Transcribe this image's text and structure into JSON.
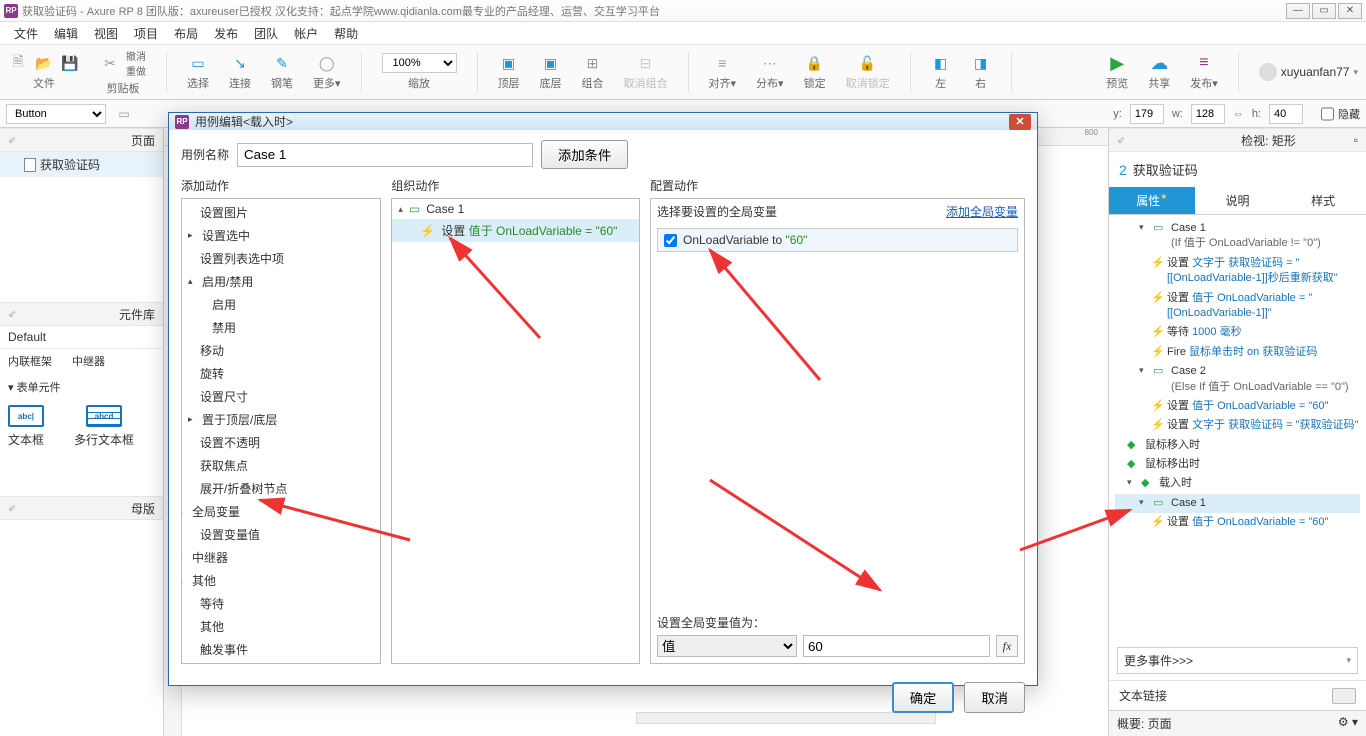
{
  "title": "获取验证码 - Axure RP 8 团队版：axureuser已授权 汉化支持：起点学院www.qidianla.com最专业的产品经理、运营、交互学习平台",
  "menu": [
    "文件",
    "编辑",
    "视图",
    "项目",
    "布局",
    "发布",
    "团队",
    "帐户",
    "帮助"
  ],
  "toolbar": {
    "groups": [
      {
        "label": "文件",
        "icons": [
          "□",
          "□",
          "□"
        ]
      },
      {
        "label": "剪贴板",
        "icons": [
          "✂",
          "📋"
        ],
        "extra": [
          "撤消",
          "重做"
        ]
      },
      {
        "label": "选择",
        "icon": "▭"
      },
      {
        "label": "连接",
        "icon": "↘"
      },
      {
        "label": "钢笔",
        "icon": "✎"
      },
      {
        "label": "更多▾",
        "icon": "◯"
      },
      {
        "label": "缩放",
        "zoom": "100%"
      },
      {
        "label": "顶层",
        "icon": "▣"
      },
      {
        "label": "底层",
        "icon": "▣"
      },
      {
        "label": "组合",
        "icon": "⊞"
      },
      {
        "label": "取消组合",
        "icon": "⊟"
      },
      {
        "label": "对齐▾",
        "icon": "≡"
      },
      {
        "label": "分布▾",
        "icon": "⋯"
      },
      {
        "label": "锁定",
        "icon": "🔒"
      },
      {
        "label": "取消锁定",
        "icon": "🔓"
      },
      {
        "label": "左",
        "icon": "◧"
      },
      {
        "label": "右",
        "icon": "◨"
      },
      {
        "label": "预览",
        "icon": "▶",
        "color": "#28a745"
      },
      {
        "label": "共享",
        "icon": "☁",
        "color": "#2196d6"
      },
      {
        "label": "发布▾",
        "icon": "≡",
        "color": "#8b3a8b"
      }
    ],
    "user": "xuyuanfan77"
  },
  "propbar": {
    "shape_select": "Button",
    "y_label": "y:",
    "y": "179",
    "w_label": "w:",
    "w": "128",
    "h_label": "h:",
    "h": "40",
    "hidden": "隐藏"
  },
  "left": {
    "page_panel": "页面",
    "page_item": "获取验证码",
    "lib_panel": "元件库",
    "default_lib": "Default",
    "lib_cats": [
      "内联框架",
      "中继器"
    ],
    "form_header": "表单元件",
    "lib_items": [
      "文本框",
      "多行文本框"
    ],
    "master_panel": "母版"
  },
  "modal": {
    "title": "用例编辑<载入时>",
    "case_name_label": "用例名称",
    "case_name": "Case 1",
    "add_condition": "添加条件",
    "col1_h": "添加动作",
    "actions": [
      "设置图片",
      "设置选中",
      "设置列表选中项",
      "启用/禁用",
      "启用",
      "禁用",
      "移动",
      "旋转",
      "设置尺寸",
      "置于顶层/底层",
      "设置不透明",
      "获取焦点",
      "展开/折叠树节点",
      "全局变量",
      "设置变量值",
      "中继器",
      "其他",
      "等待",
      "其他",
      "触发事件"
    ],
    "col2_h": "组织动作",
    "org_case": "Case 1",
    "org_action_prefix": "设置 ",
    "org_action_green": "值于 OnLoadVariable = \"60\"",
    "col3_h": "配置动作",
    "cfg_prompt": "选择要设置的全局变量",
    "add_global": "添加全局变量",
    "var_name": "OnLoadVariable to ",
    "var_value_green": "\"60\"",
    "value_label": "设置全局变量值为：",
    "value_type": "值",
    "value_input": "60",
    "fx": "fx",
    "ok": "确定",
    "cancel": "取消"
  },
  "right": {
    "inspect_label": "检视: 矩形",
    "count": "2",
    "widget_name": "获取验证码",
    "tabs": [
      "属性",
      "说明",
      "样式"
    ],
    "tree": {
      "case1": "Case 1",
      "case1_cond": "(If 值于 OnLoadVariable != \"0\")",
      "a1_pre": "设置 ",
      "a1_link": "文字于 获取验证码 = \"[[OnLoadVariable-1]]秒后重新获取\"",
      "a2_pre": "设置 ",
      "a2_link": "值于 OnLoadVariable = \"[[OnLoadVariable-1]]\"",
      "a3_pre": "等待 ",
      "a3_link": "1000 毫秒",
      "a4_pre": "Fire ",
      "a4_link": "鼠标单击时 on 获取验证码",
      "case2": "Case 2",
      "case2_cond": "(Else If 值于 OnLoadVariable == \"0\")",
      "b1_pre": "设置 ",
      "b1_link": "值于 OnLoadVariable = \"60\"",
      "b2_pre": "设置 ",
      "b2_link": "文字于 获取验证码 = \"获取验证码\"",
      "ev_mouseover": "鼠标移入时",
      "ev_mouseout": "鼠标移出时",
      "ev_load": "载入时",
      "load_case": "Case 1",
      "load_a_pre": "设置 ",
      "load_a_link": "值于 OnLoadVariable = \"60\""
    },
    "more_events": "更多事件>>>",
    "text_link": "文本链接",
    "overview": "概要: 页面"
  }
}
